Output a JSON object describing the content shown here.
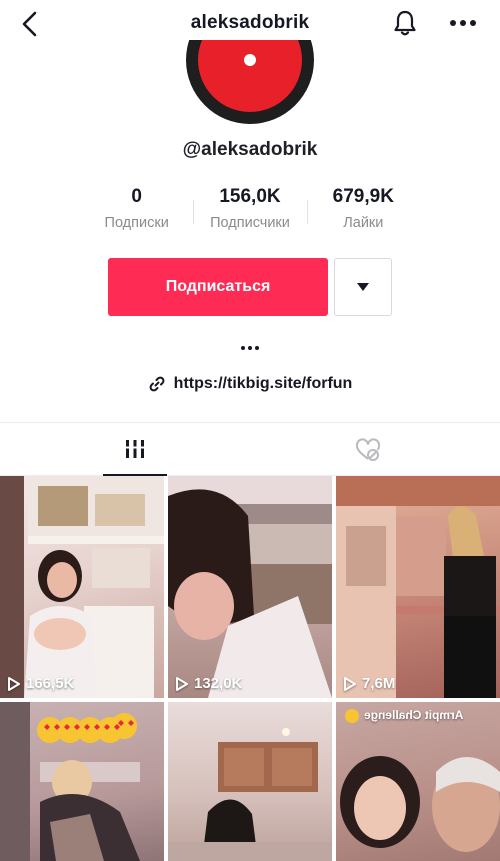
{
  "header": {
    "title": "aleksadobrik"
  },
  "profile": {
    "handle": "@aleksadobrik"
  },
  "stats": [
    {
      "value": "0",
      "label": "Подписки"
    },
    {
      "value": "156,0K",
      "label": "Подписчики"
    },
    {
      "value": "679,9K",
      "label": "Лайки"
    }
  ],
  "actions": {
    "follow_label": "Подписаться"
  },
  "bio": {
    "link": "https://tikbig.site/forfun"
  },
  "videos": [
    {
      "views": "166,5K"
    },
    {
      "views": "132,0K"
    },
    {
      "views": "7,6M"
    },
    {
      "views": ""
    },
    {
      "views": ""
    },
    {
      "views": "",
      "caption": "Armpit Challenge"
    }
  ],
  "colors": {
    "accent": "#fe2c55",
    "text": "#161823",
    "muted": "#8a8b91"
  }
}
